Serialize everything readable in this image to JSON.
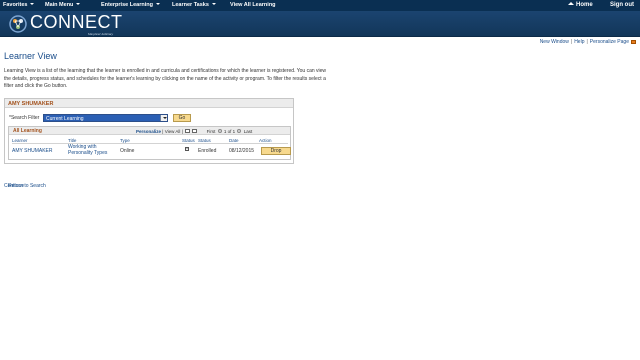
{
  "topnav": {
    "items": [
      "Favorites",
      "Main Menu",
      "Enterprise Learning",
      "Learner Tasks",
      "View All Learning"
    ],
    "home": "Home",
    "signout": "Sign out"
  },
  "banner": {
    "logo_text": "CONNECT",
    "logo_sub": "Maryland Judiciary"
  },
  "pagebar": {
    "new_window": "New Window",
    "help": "Help",
    "personalize": "Personalize Page"
  },
  "page": {
    "title": "Learner View",
    "intro": "Learning View is a list of the learning that the learner is enrolled in and curricula and certifications for which the learner is registered. You can view the details, progress status, and schedules for the learner's learning by clicking on the name of the activity or program. To filter the results select a filter and click the Go button."
  },
  "learner": {
    "name": "AMY SHUMAKER",
    "filter_label": "*Search Filter",
    "filter_value": "Current Learning",
    "go_label": "Go"
  },
  "grid": {
    "title": "All Learning",
    "personalize": "Personalize",
    "view_all": "View All",
    "first": "First",
    "range": "1 of 1",
    "last": "Last",
    "headers": [
      "Learner",
      "Title",
      "Type",
      "Status",
      "Status",
      "Date",
      "Action"
    ],
    "row": {
      "learner": "AMY SHUMAKER",
      "title_line1": "Working with",
      "title_line2": "Personality Types",
      "type": "Online",
      "status": "Enrolled",
      "date": "08/12/2015",
      "action": "Drop"
    }
  },
  "footer": {
    "return_a": "Continue",
    "return_b": "Return to Search"
  },
  "colors": {
    "nav_bg": "#0a2f52",
    "banner_bg": "#123659",
    "link": "#1a4d8a",
    "section_title": "#a3521d",
    "button_bg": "#f7d98e"
  }
}
